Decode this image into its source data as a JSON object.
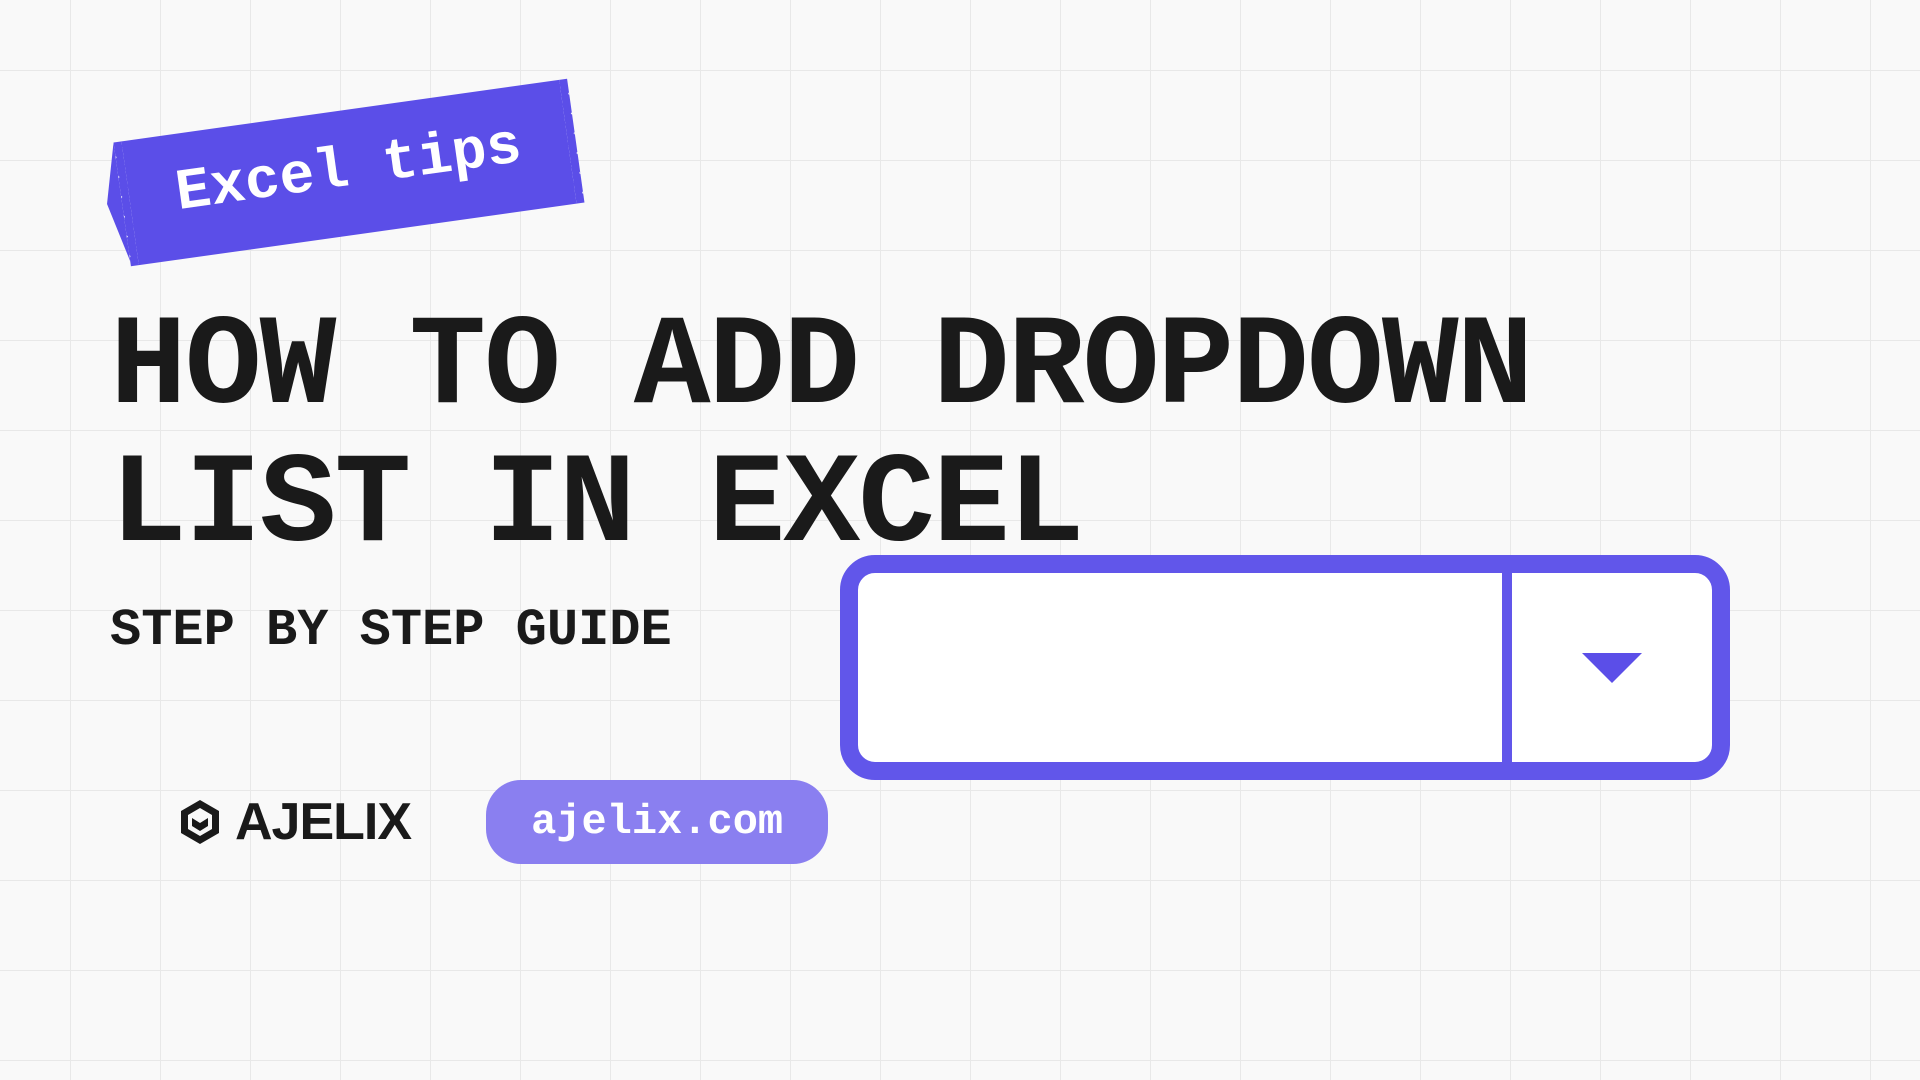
{
  "tape_label": "Excel tips",
  "title": "HOW TO ADD DROPDOWN LIST IN EXCEL",
  "subtitle": "STEP BY STEP GUIDE",
  "logo_text": "AJELIX",
  "url": "ajelix.com",
  "colors": {
    "accent": "#5b4ee8",
    "accent_light": "#8a7ff0",
    "text": "#1a1a1a"
  }
}
